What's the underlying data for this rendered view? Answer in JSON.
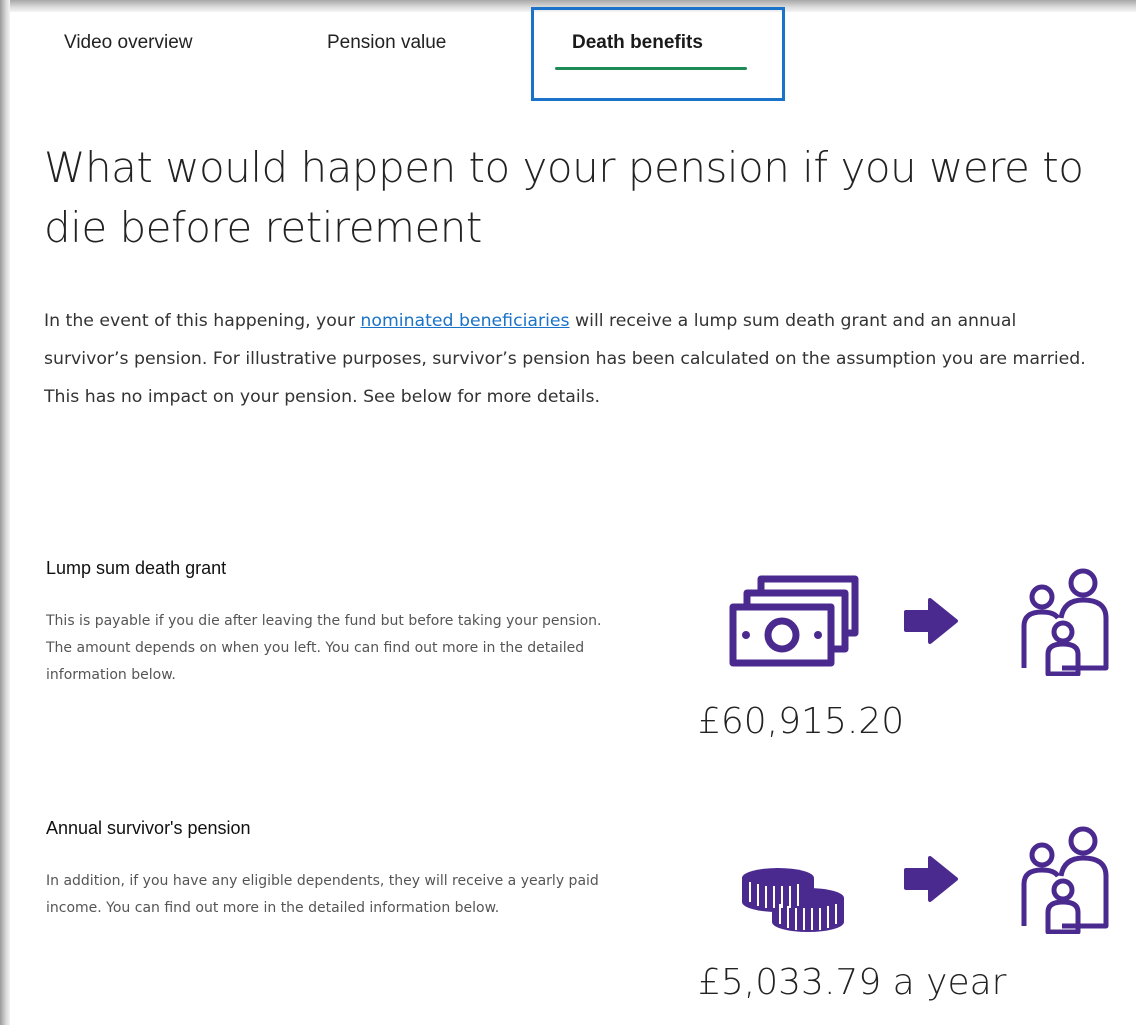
{
  "tabs": [
    {
      "label": "Video overview"
    },
    {
      "label": "Pension value"
    },
    {
      "label": "Death benefits"
    }
  ],
  "heading": "What would happen to your pension if you were to die before retirement",
  "intro": {
    "before_link": "In the event of this happening, your ",
    "link_text": "nominated beneficiaries",
    "after_link": " will receive a lump sum death grant and an annual survivor’s pension. For illustrative purposes, survivor’s pension has been calculated on the assumption you are married. This has no impact on your pension. See below for more details."
  },
  "lump_sum": {
    "title": "Lump sum death grant",
    "description": "This is payable if you die after leaving the fund but before taking your pension. The amount depends on when you left. You can find out more in the detailed information below.",
    "amount": "£60,915.20"
  },
  "survivor": {
    "title": "Annual survivor's pension",
    "description": "In addition, if you have any eligible dependents, they will receive a yearly paid income. You can find out more in the detailed information below.",
    "amount": "£5,033.79 a year"
  },
  "colors": {
    "icon_purple": "#4b2a8f",
    "tab_underline": "#1e8a55",
    "highlight_box": "#1a73c8",
    "link": "#1a73c8"
  },
  "icons": [
    "banknotes-icon",
    "arrow-right-icon",
    "family-icon",
    "coins-icon"
  ]
}
